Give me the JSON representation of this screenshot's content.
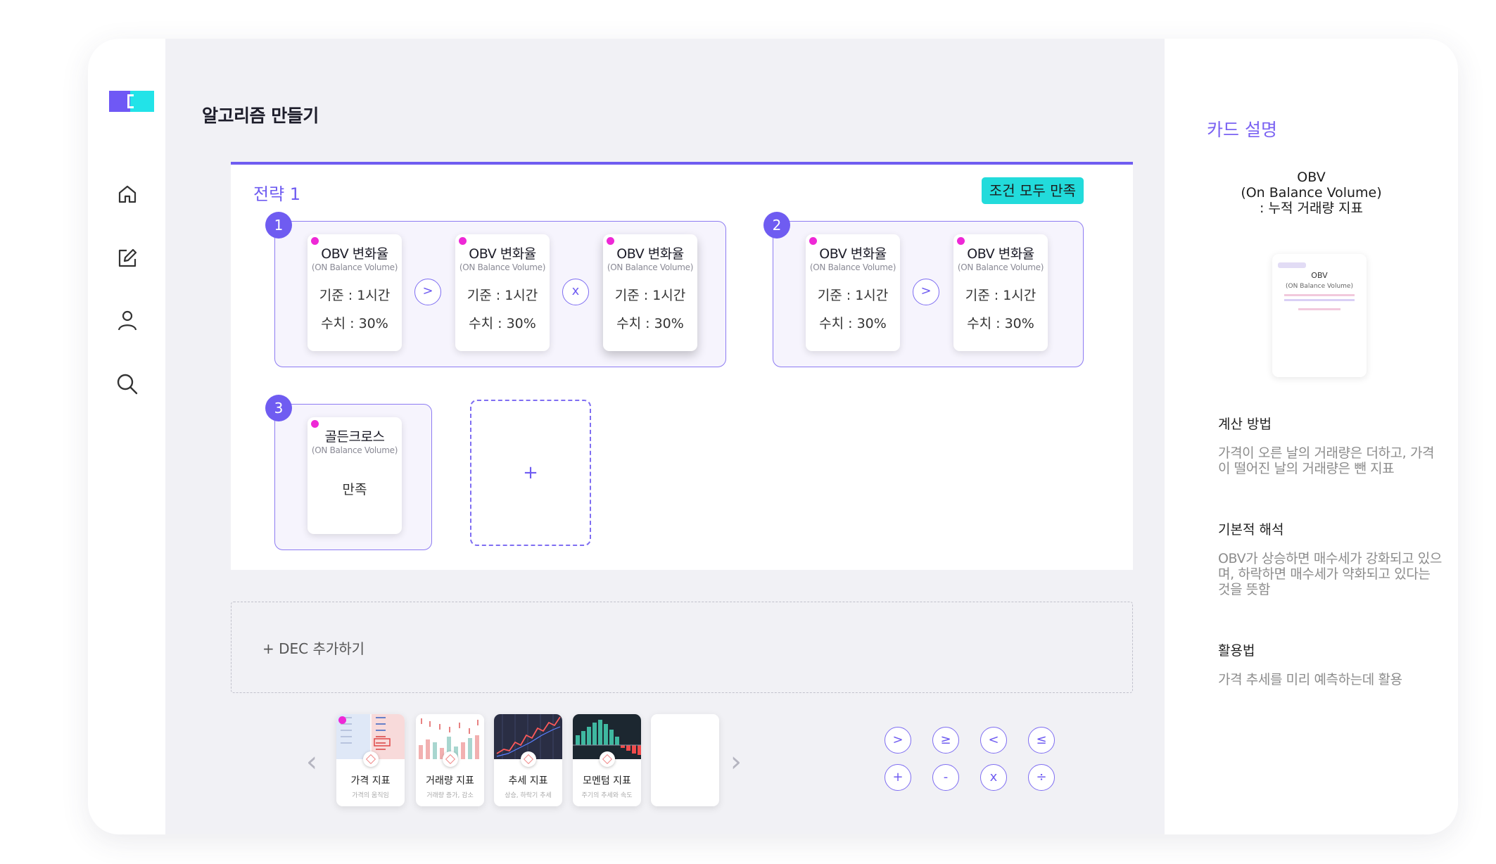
{
  "page_title": "알고리즘 만들기",
  "sidebar": {
    "items": [
      {
        "name": "home-icon"
      },
      {
        "name": "edit-icon"
      },
      {
        "name": "user-icon"
      },
      {
        "name": "search-icon"
      }
    ]
  },
  "strategy": {
    "title": "전략 1",
    "badge": "조건 모두 만족",
    "groups": [
      {
        "number": "1",
        "cards": [
          {
            "title": "OBV 변화율",
            "subtitle": "(ON Balance Volume)",
            "basis": "기준 : 1시간",
            "value": "수치 : 30%"
          },
          {
            "title": "OBV 변화율",
            "subtitle": "(ON Balance Volume)",
            "basis": "기준 : 1시간",
            "value": "수치 : 30%"
          },
          {
            "title": "OBV 변화율",
            "subtitle": "(ON Balance Volume)",
            "basis": "기준 : 1시간",
            "value": "수치 : 30%"
          }
        ],
        "operators": [
          ">",
          "x"
        ]
      },
      {
        "number": "2",
        "cards": [
          {
            "title": "OBV 변화율",
            "subtitle": "(ON Balance Volume)",
            "basis": "기준 : 1시간",
            "value": "수치 : 30%"
          },
          {
            "title": "OBV 변화율",
            "subtitle": "(ON Balance Volume)",
            "basis": "기준 : 1시간",
            "value": "수치 : 30%"
          }
        ],
        "operators": [
          ">"
        ]
      },
      {
        "number": "3",
        "cards": [
          {
            "title": "골든크로스",
            "subtitle": "(ON Balance Volume)",
            "status": "만족"
          }
        ]
      }
    ],
    "add_label": "+"
  },
  "dec_add_label": "+ DEC 추가하기",
  "nav": {
    "prev": "‹",
    "next": "›"
  },
  "indicator_cards": [
    {
      "label": "가격 지표",
      "sub": "가격의 움직임"
    },
    {
      "label": "거래량 지표",
      "sub": "거래량 증가, 감소"
    },
    {
      "label": "추세 지표",
      "sub": "상승, 하락기 추세"
    },
    {
      "label": "모멘텀 지표",
      "sub": "주기의 추세와 속도"
    }
  ],
  "operators_palette": [
    ">",
    "≥",
    "<",
    "≤",
    "+",
    "-",
    "x",
    "÷"
  ],
  "panel": {
    "title": "카드 설명",
    "head_line1": "OBV",
    "head_line2": "(On Balance Volume)",
    "head_line3": ": 누적 거래량 지표",
    "thumb_title": "OBV",
    "thumb_sub": "(ON Balance Volume)",
    "sections": [
      {
        "heading": "계산 방법",
        "body": "가격이 오른 날의 거래량은 더하고, 가격이 떨어진 날의 거래량은 뺀 지표"
      },
      {
        "heading": "기본적 해석",
        "body": "OBV가 상승하면 매수세가 강화되고 있으며, 하락하면 매수세가 약화되고 있다는 것을 뜻함"
      },
      {
        "heading": "활용법",
        "body": "가격 추세를 미리 예측하는데 활용"
      }
    ]
  },
  "colors": {
    "accent": "#6f5cf1",
    "teal": "#22dbdb",
    "magenta": "#ee28d6"
  }
}
